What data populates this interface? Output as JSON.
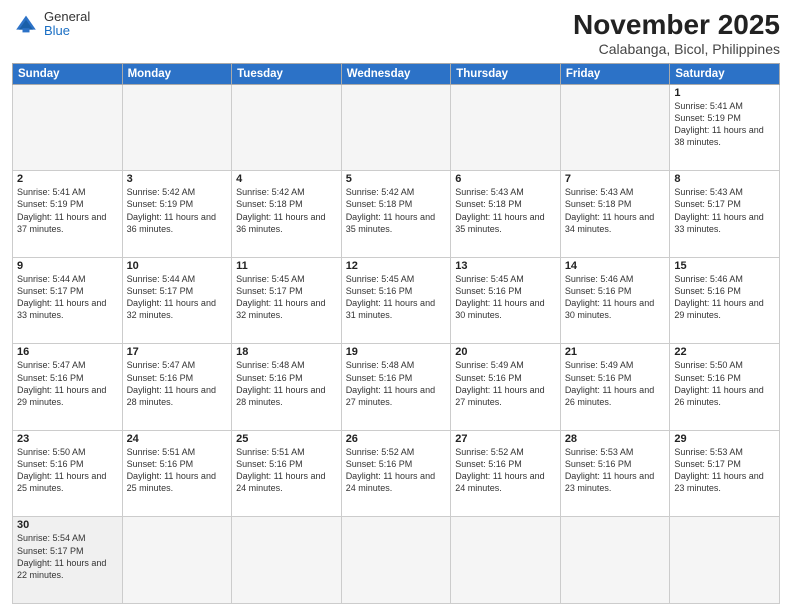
{
  "header": {
    "logo_general": "General",
    "logo_blue": "Blue",
    "month_title": "November 2025",
    "location": "Calabanga, Bicol, Philippines"
  },
  "days_of_week": [
    "Sunday",
    "Monday",
    "Tuesday",
    "Wednesday",
    "Thursday",
    "Friday",
    "Saturday"
  ],
  "weeks": [
    [
      {
        "day": "",
        "empty": true
      },
      {
        "day": "",
        "empty": true
      },
      {
        "day": "",
        "empty": true
      },
      {
        "day": "",
        "empty": true
      },
      {
        "day": "",
        "empty": true
      },
      {
        "day": "",
        "empty": true
      },
      {
        "day": "1",
        "sunrise": "5:41 AM",
        "sunset": "5:19 PM",
        "daylight": "11 hours and 38 minutes."
      }
    ],
    [
      {
        "day": "2",
        "sunrise": "5:41 AM",
        "sunset": "5:19 PM",
        "daylight": "11 hours and 37 minutes."
      },
      {
        "day": "3",
        "sunrise": "5:42 AM",
        "sunset": "5:19 PM",
        "daylight": "11 hours and 36 minutes."
      },
      {
        "day": "4",
        "sunrise": "5:42 AM",
        "sunset": "5:18 PM",
        "daylight": "11 hours and 36 minutes."
      },
      {
        "day": "5",
        "sunrise": "5:42 AM",
        "sunset": "5:18 PM",
        "daylight": "11 hours and 35 minutes."
      },
      {
        "day": "6",
        "sunrise": "5:43 AM",
        "sunset": "5:18 PM",
        "daylight": "11 hours and 35 minutes."
      },
      {
        "day": "7",
        "sunrise": "5:43 AM",
        "sunset": "5:18 PM",
        "daylight": "11 hours and 34 minutes."
      },
      {
        "day": "8",
        "sunrise": "5:43 AM",
        "sunset": "5:17 PM",
        "daylight": "11 hours and 33 minutes."
      }
    ],
    [
      {
        "day": "9",
        "sunrise": "5:44 AM",
        "sunset": "5:17 PM",
        "daylight": "11 hours and 33 minutes."
      },
      {
        "day": "10",
        "sunrise": "5:44 AM",
        "sunset": "5:17 PM",
        "daylight": "11 hours and 32 minutes."
      },
      {
        "day": "11",
        "sunrise": "5:45 AM",
        "sunset": "5:17 PM",
        "daylight": "11 hours and 32 minutes."
      },
      {
        "day": "12",
        "sunrise": "5:45 AM",
        "sunset": "5:16 PM",
        "daylight": "11 hours and 31 minutes."
      },
      {
        "day": "13",
        "sunrise": "5:45 AM",
        "sunset": "5:16 PM",
        "daylight": "11 hours and 30 minutes."
      },
      {
        "day": "14",
        "sunrise": "5:46 AM",
        "sunset": "5:16 PM",
        "daylight": "11 hours and 30 minutes."
      },
      {
        "day": "15",
        "sunrise": "5:46 AM",
        "sunset": "5:16 PM",
        "daylight": "11 hours and 29 minutes."
      }
    ],
    [
      {
        "day": "16",
        "sunrise": "5:47 AM",
        "sunset": "5:16 PM",
        "daylight": "11 hours and 29 minutes."
      },
      {
        "day": "17",
        "sunrise": "5:47 AM",
        "sunset": "5:16 PM",
        "daylight": "11 hours and 28 minutes."
      },
      {
        "day": "18",
        "sunrise": "5:48 AM",
        "sunset": "5:16 PM",
        "daylight": "11 hours and 28 minutes."
      },
      {
        "day": "19",
        "sunrise": "5:48 AM",
        "sunset": "5:16 PM",
        "daylight": "11 hours and 27 minutes."
      },
      {
        "day": "20",
        "sunrise": "5:49 AM",
        "sunset": "5:16 PM",
        "daylight": "11 hours and 27 minutes."
      },
      {
        "day": "21",
        "sunrise": "5:49 AM",
        "sunset": "5:16 PM",
        "daylight": "11 hours and 26 minutes."
      },
      {
        "day": "22",
        "sunrise": "5:50 AM",
        "sunset": "5:16 PM",
        "daylight": "11 hours and 26 minutes."
      }
    ],
    [
      {
        "day": "23",
        "sunrise": "5:50 AM",
        "sunset": "5:16 PM",
        "daylight": "11 hours and 25 minutes."
      },
      {
        "day": "24",
        "sunrise": "5:51 AM",
        "sunset": "5:16 PM",
        "daylight": "11 hours and 25 minutes."
      },
      {
        "day": "25",
        "sunrise": "5:51 AM",
        "sunset": "5:16 PM",
        "daylight": "11 hours and 24 minutes."
      },
      {
        "day": "26",
        "sunrise": "5:52 AM",
        "sunset": "5:16 PM",
        "daylight": "11 hours and 24 minutes."
      },
      {
        "day": "27",
        "sunrise": "5:52 AM",
        "sunset": "5:16 PM",
        "daylight": "11 hours and 24 minutes."
      },
      {
        "day": "28",
        "sunrise": "5:53 AM",
        "sunset": "5:16 PM",
        "daylight": "11 hours and 23 minutes."
      },
      {
        "day": "29",
        "sunrise": "5:53 AM",
        "sunset": "5:17 PM",
        "daylight": "11 hours and 23 minutes."
      }
    ],
    [
      {
        "day": "30",
        "sunrise": "5:54 AM",
        "sunset": "5:17 PM",
        "daylight": "11 hours and 22 minutes."
      },
      {
        "day": "",
        "empty": true
      },
      {
        "day": "",
        "empty": true
      },
      {
        "day": "",
        "empty": true
      },
      {
        "day": "",
        "empty": true
      },
      {
        "day": "",
        "empty": true
      },
      {
        "day": "",
        "empty": true
      }
    ]
  ]
}
